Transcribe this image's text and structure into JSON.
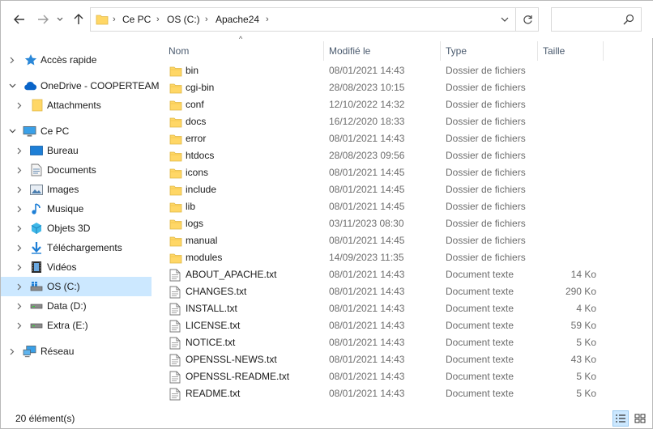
{
  "address": {
    "crumbs": [
      "Ce PC",
      "OS (C:)",
      "Apache24"
    ]
  },
  "search": {
    "placeholder": ""
  },
  "nav": {
    "items": [
      {
        "label": "Accès rapide",
        "icon": "star-icon"
      },
      {
        "label": "OneDrive - COOPERTEAM",
        "icon": "cloud-icon"
      },
      {
        "label": "Attachments",
        "icon": "folder-icon"
      },
      {
        "label": "Ce PC",
        "icon": "computer-icon"
      },
      {
        "label": "Bureau",
        "icon": "desktop-icon"
      },
      {
        "label": "Documents",
        "icon": "documents-icon"
      },
      {
        "label": "Images",
        "icon": "images-icon"
      },
      {
        "label": "Musique",
        "icon": "music-icon"
      },
      {
        "label": "Objets 3D",
        "icon": "objects3d-icon"
      },
      {
        "label": "Téléchargements",
        "icon": "downloads-icon"
      },
      {
        "label": "Vidéos",
        "icon": "videos-icon"
      },
      {
        "label": "OS (C:)",
        "icon": "os-drive-icon"
      },
      {
        "label": "Data (D:)",
        "icon": "drive-icon"
      },
      {
        "label": "Extra (E:)",
        "icon": "drive-icon"
      },
      {
        "label": "Réseau",
        "icon": "network-icon"
      }
    ]
  },
  "columns": {
    "name": "Nom",
    "date": "Modifié le",
    "type": "Type",
    "size": "Taille"
  },
  "files": [
    {
      "name": "bin",
      "date": "08/01/2021 14:43",
      "type": "Dossier de fichiers",
      "size": "",
      "kind": "folder"
    },
    {
      "name": "cgi-bin",
      "date": "28/08/2023 10:15",
      "type": "Dossier de fichiers",
      "size": "",
      "kind": "folder"
    },
    {
      "name": "conf",
      "date": "12/10/2022 14:32",
      "type": "Dossier de fichiers",
      "size": "",
      "kind": "folder"
    },
    {
      "name": "docs",
      "date": "16/12/2020 18:33",
      "type": "Dossier de fichiers",
      "size": "",
      "kind": "folder"
    },
    {
      "name": "error",
      "date": "08/01/2021 14:43",
      "type": "Dossier de fichiers",
      "size": "",
      "kind": "folder"
    },
    {
      "name": "htdocs",
      "date": "28/08/2023 09:56",
      "type": "Dossier de fichiers",
      "size": "",
      "kind": "folder"
    },
    {
      "name": "icons",
      "date": "08/01/2021 14:45",
      "type": "Dossier de fichiers",
      "size": "",
      "kind": "folder"
    },
    {
      "name": "include",
      "date": "08/01/2021 14:45",
      "type": "Dossier de fichiers",
      "size": "",
      "kind": "folder"
    },
    {
      "name": "lib",
      "date": "08/01/2021 14:45",
      "type": "Dossier de fichiers",
      "size": "",
      "kind": "folder"
    },
    {
      "name": "logs",
      "date": "03/11/2023 08:30",
      "type": "Dossier de fichiers",
      "size": "",
      "kind": "folder"
    },
    {
      "name": "manual",
      "date": "08/01/2021 14:45",
      "type": "Dossier de fichiers",
      "size": "",
      "kind": "folder"
    },
    {
      "name": "modules",
      "date": "14/09/2023 11:35",
      "type": "Dossier de fichiers",
      "size": "",
      "kind": "folder"
    },
    {
      "name": "ABOUT_APACHE.txt",
      "date": "08/01/2021 14:43",
      "type": "Document texte",
      "size": "14 Ko",
      "kind": "file"
    },
    {
      "name": "CHANGES.txt",
      "date": "08/01/2021 14:43",
      "type": "Document texte",
      "size": "290 Ko",
      "kind": "file"
    },
    {
      "name": "INSTALL.txt",
      "date": "08/01/2021 14:43",
      "type": "Document texte",
      "size": "4 Ko",
      "kind": "file"
    },
    {
      "name": "LICENSE.txt",
      "date": "08/01/2021 14:43",
      "type": "Document texte",
      "size": "59 Ko",
      "kind": "file"
    },
    {
      "name": "NOTICE.txt",
      "date": "08/01/2021 14:43",
      "type": "Document texte",
      "size": "5 Ko",
      "kind": "file"
    },
    {
      "name": "OPENSSL-NEWS.txt",
      "date": "08/01/2021 14:43",
      "type": "Document texte",
      "size": "43 Ko",
      "kind": "file"
    },
    {
      "name": "OPENSSL-README.txt",
      "date": "08/01/2021 14:43",
      "type": "Document texte",
      "size": "5 Ko",
      "kind": "file"
    },
    {
      "name": "README.txt",
      "date": "08/01/2021 14:43",
      "type": "Document texte",
      "size": "5 Ko",
      "kind": "file"
    }
  ],
  "status": {
    "count_text": "20 élément(s)"
  },
  "colors": {
    "folder": "#ffd766",
    "selection": "#cce8ff",
    "accent": "#0078d7"
  }
}
